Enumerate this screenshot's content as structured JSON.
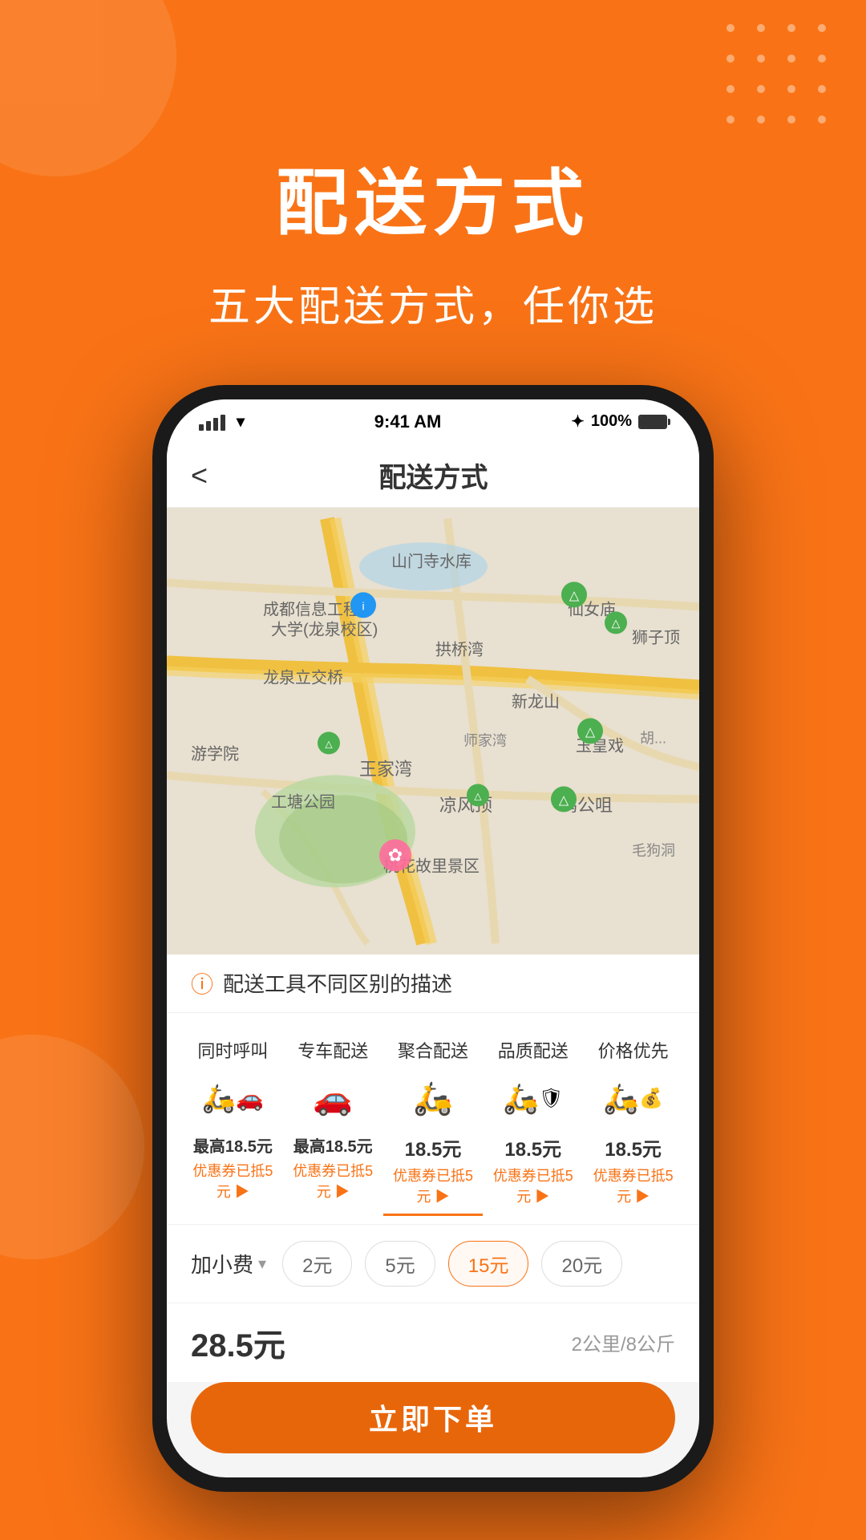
{
  "background": {
    "color": "#F97316"
  },
  "header": {
    "main_title": "配送方式",
    "sub_title": "五大配送方式，任你选"
  },
  "phone": {
    "status_bar": {
      "time": "9:41 AM",
      "battery": "100%",
      "bluetooth": "⌥"
    },
    "nav": {
      "title": "配送方式",
      "back_label": "<"
    },
    "warning": {
      "text": "配送工具不同区别的描述"
    },
    "delivery_options": [
      {
        "title": "同时呼叫",
        "price": "最高18.5元",
        "coupon": "优惠券已抵5元 ▶",
        "icon": "🛵🚗",
        "active": false
      },
      {
        "title": "专车配送",
        "price": "最高18.5元",
        "coupon": "优惠券已抵5元 ▶",
        "icon": "🚗",
        "active": false
      },
      {
        "title": "聚合配送",
        "price": "18.5元",
        "coupon": "优惠券已抵5元 ▶",
        "icon": "🛵",
        "active": true
      },
      {
        "title": "品质配送",
        "price": "18.5元",
        "coupon": "优惠券已抵5元 ▶",
        "icon": "🛵🛡",
        "active": false
      },
      {
        "title": "价格优先",
        "price": "18.5元",
        "coupon": "优惠券已抵5元 ▶",
        "icon": "🛵💰",
        "active": false
      }
    ],
    "extra_fee": {
      "label": "加小费",
      "options": [
        "2元",
        "5元",
        "15元",
        "20元"
      ],
      "selected": "15元"
    },
    "total": {
      "price": "28.5元",
      "distance": "2公里/8公斤"
    },
    "order_button": "立即下单"
  }
}
